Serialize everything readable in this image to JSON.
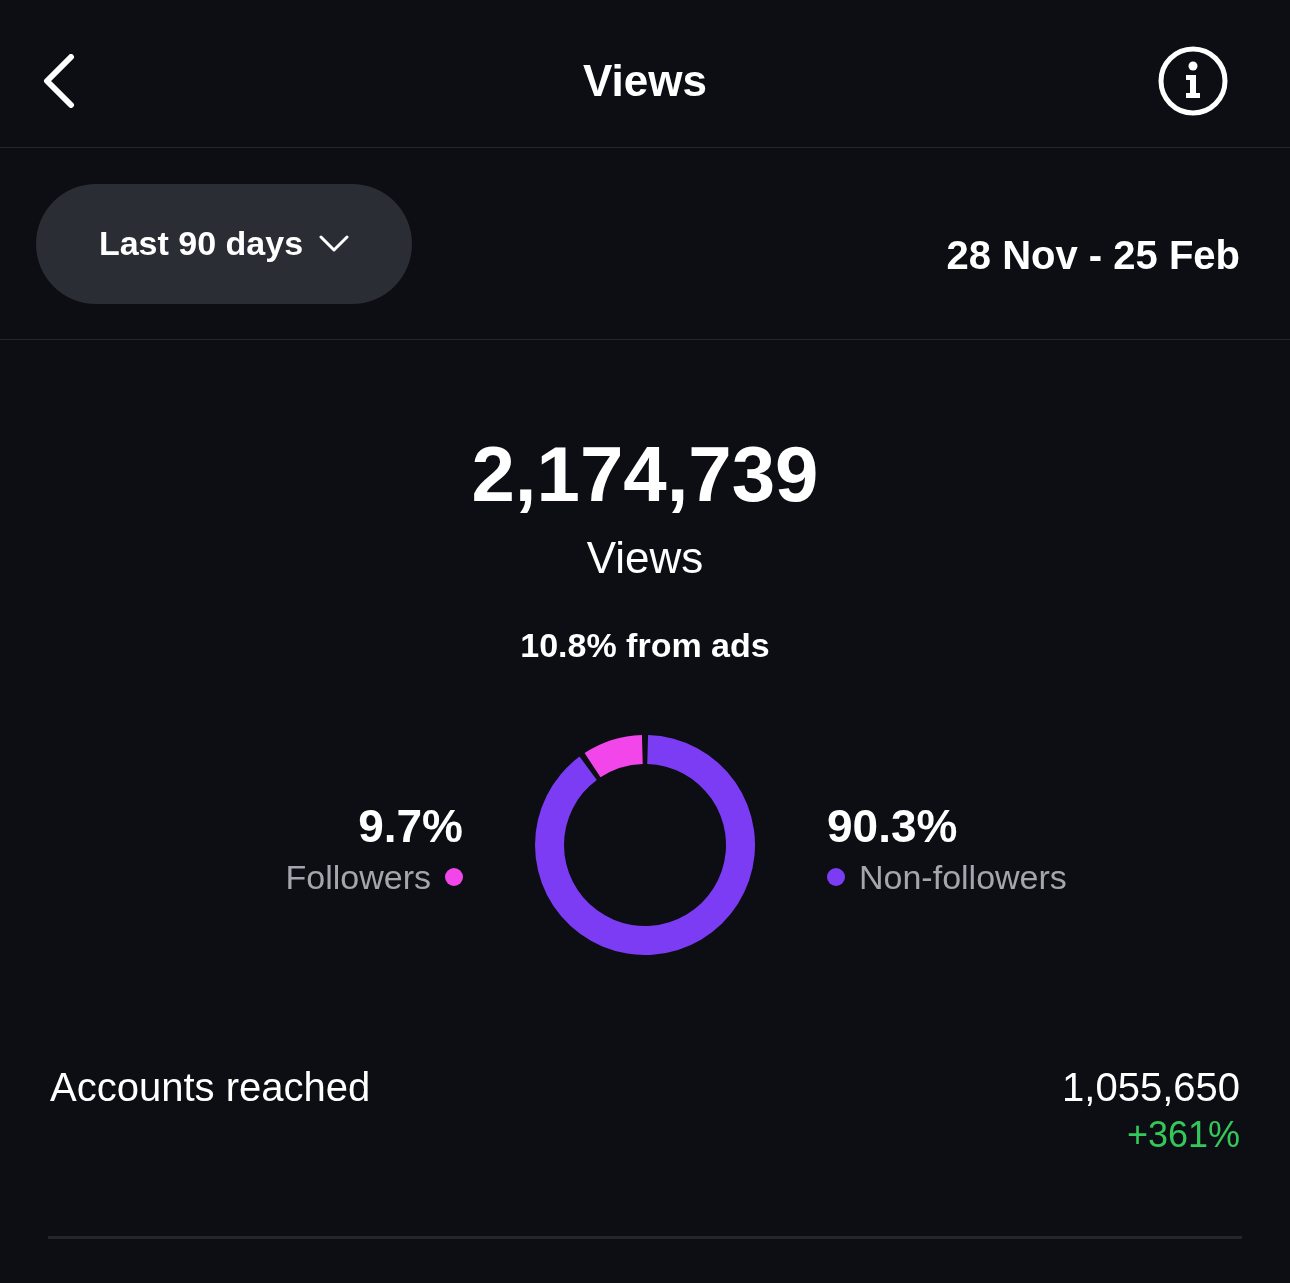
{
  "header": {
    "title": "Views"
  },
  "filter": {
    "period": "Last 90 days",
    "date_range": "28 Nov - 25 Feb"
  },
  "summary": {
    "total": "2,174,739",
    "label": "Views",
    "ads_share": "10.8% from ads"
  },
  "audience": {
    "chart_data": {
      "type": "donut",
      "categories": [
        "Followers",
        "Non-followers"
      ],
      "values": [
        9.7,
        90.3
      ]
    },
    "legend": [
      {
        "value": "9.7%",
        "color": "#f246ea"
      },
      {
        "value": "90.3%",
        "color": "#7b3cf4"
      }
    ]
  },
  "metrics": [
    {
      "label": "Accounts reached",
      "value": "1,055,650",
      "change": "+361%",
      "positive": true
    }
  ]
}
